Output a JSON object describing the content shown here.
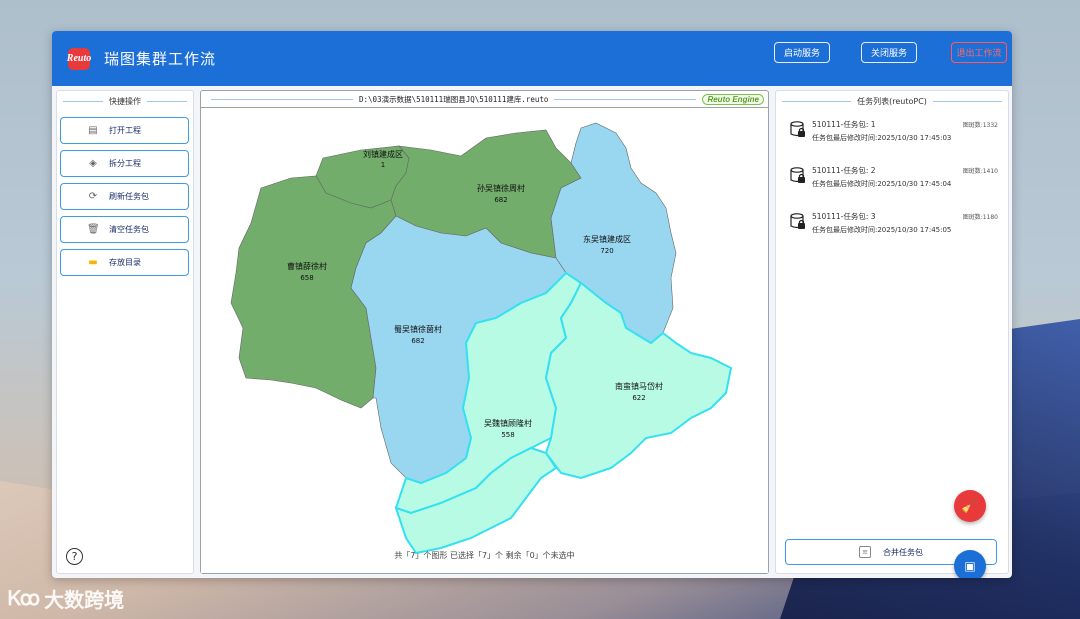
{
  "app": {
    "logo_text": "Reuto",
    "title": "瑞图集群工作流"
  },
  "titlebar_buttons": {
    "start": "启动服务",
    "stop": "关闭服务",
    "exit": "退出工作流"
  },
  "quick_ops": {
    "heading": "快捷操作",
    "items": [
      {
        "label": "打开工程",
        "icon": "open-project-icon"
      },
      {
        "label": "拆分工程",
        "icon": "split-project-icon"
      },
      {
        "label": "刷新任务包",
        "icon": "refresh-icon"
      },
      {
        "label": "清空任务包",
        "icon": "trash-icon"
      },
      {
        "label": "存放目录",
        "icon": "folder-icon"
      }
    ]
  },
  "map": {
    "path": "D:\\03演示数据\\510111瑞图县JQ\\510111建库.reuto",
    "engine": "Reuto Engine",
    "footer": "共「7」个图形 已选择「7」个 剩余「0」个未选中",
    "regions": [
      {
        "name": "刘镇建成区",
        "value": "1",
        "color": "#72ad6b"
      },
      {
        "name": "孙吴镇徐周村",
        "value": "682",
        "color": "#72ad6b"
      },
      {
        "name": "曹镇薛徐村",
        "value": "658",
        "color": "#72ad6b"
      },
      {
        "name": "东吴镇建成区",
        "value": "720",
        "color": "#99d6f0"
      },
      {
        "name": "蜀吴镇徐菌村",
        "value": "682",
        "color": "#99d6f0"
      },
      {
        "name": "吴魏镇顾隆村",
        "value": "558",
        "color": "#b7fbe5"
      },
      {
        "name": "南蛮镇马岱村",
        "value": "622",
        "color": "#b7fbe5"
      }
    ]
  },
  "tasks": {
    "heading": "任务列表(reutoPC)",
    "items": [
      {
        "name": "510111-任务包: 1",
        "time": "任务包最后修改时间:2025/10/30 17:45:03",
        "count": "图斑数:1332"
      },
      {
        "name": "510111-任务包: 2",
        "time": "任务包最后修改时间:2025/10/30 17:45:04",
        "count": "图斑数:1410"
      },
      {
        "name": "510111-任务包: 3",
        "time": "任务包最后修改时间:2025/10/30 17:45:05",
        "count": "图斑数:1180"
      }
    ],
    "merge_label": "合并任务包"
  },
  "watermark": {
    "logo": "Ꮶꝏ",
    "text": "大数跨境"
  }
}
